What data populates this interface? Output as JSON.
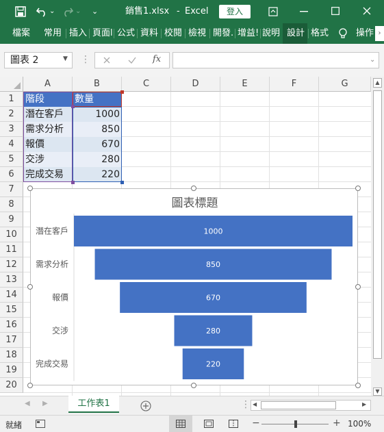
{
  "titlebar": {
    "filename": "銷售1.xlsx",
    "separator": "-",
    "app": "Excel",
    "signin": "登入"
  },
  "ribbon": {
    "tabs": [
      "檔案",
      "常用",
      "插入",
      "頁面l",
      "公式",
      "資料",
      "校閱",
      "檢視",
      "開發.",
      "增益!",
      "說明",
      "設計",
      "格式"
    ],
    "tell_me": "操作"
  },
  "formula_bar": {
    "name_box": "圖表 2",
    "fx": "fx",
    "value": ""
  },
  "columns": [
    "A",
    "B",
    "C",
    "D",
    "E",
    "F",
    "G"
  ],
  "rows": [
    "1",
    "2",
    "3",
    "4",
    "5",
    "6",
    "7",
    "8",
    "9",
    "10",
    "11",
    "12",
    "13",
    "14",
    "15",
    "16",
    "17",
    "18",
    "19",
    "20"
  ],
  "table": {
    "header": [
      "階段",
      "數量"
    ],
    "rows": [
      [
        "潛在客戶",
        "1000"
      ],
      [
        "需求分析",
        "850"
      ],
      [
        "報價",
        "670"
      ],
      [
        "交涉",
        "280"
      ],
      [
        "完成交易",
        "220"
      ]
    ]
  },
  "chart_data": {
    "type": "bar",
    "title": "圖表標題",
    "categories": [
      "潛在客戶",
      "需求分析",
      "報價",
      "交涉",
      "完成交易"
    ],
    "values": [
      1000,
      850,
      670,
      280,
      220
    ],
    "series": [
      {
        "values": [
          1000,
          850,
          670,
          280,
          220
        ]
      }
    ],
    "orientation": "funnel",
    "xlabel": "",
    "ylabel": "",
    "legend": "none",
    "grid": false,
    "bar_color": "#4472c4"
  },
  "sheet_tabs": [
    "工作表1"
  ],
  "status": {
    "ready": "就緒",
    "zoom": "100%",
    "minus": "−",
    "plus": "+"
  },
  "colors": {
    "excel_green": "#217346",
    "bar": "#4472c4",
    "header_fill": "#4472c4"
  }
}
